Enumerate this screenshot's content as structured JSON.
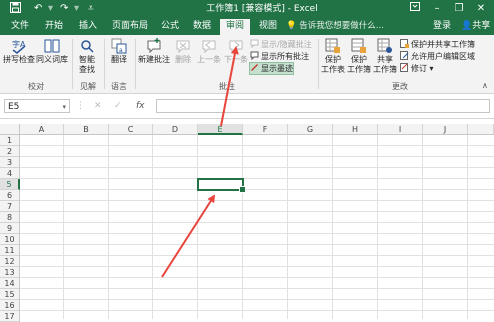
{
  "title_bar": {
    "title": "工作簿1 [兼容模式] - Excel",
    "quick_access": [
      "save-icon",
      "undo-icon",
      "redo-icon",
      "customize-icon"
    ],
    "window_controls": [
      "ribbon-options-icon",
      "minimize-icon",
      "restore-icon",
      "close-icon"
    ]
  },
  "tabs": [
    {
      "label": "文件",
      "active": false
    },
    {
      "label": "开始",
      "active": false
    },
    {
      "label": "插入",
      "active": false
    },
    {
      "label": "页面布局",
      "active": false
    },
    {
      "label": "公式",
      "active": false
    },
    {
      "label": "数据",
      "active": false
    },
    {
      "label": "审阅",
      "active": true
    },
    {
      "label": "视图",
      "active": false
    }
  ],
  "tell_me": "告诉我您想要做什么...",
  "account": {
    "login": "登录",
    "share": "共享"
  },
  "ribbon": {
    "proofing": {
      "label": "校对",
      "spell_check": "拼写检查",
      "thesaurus": "同义词库"
    },
    "insights": {
      "label": "见解",
      "smart_lookup_1": "智能",
      "smart_lookup_2": "查找"
    },
    "language": {
      "label": "语言",
      "translate": "翻译"
    },
    "comments": {
      "label": "批注",
      "new_comment": "新建批注",
      "delete": "删除",
      "previous": "上一条",
      "next": "下一条",
      "show_hide": "显示/隐藏批注",
      "show_all": "显示所有批注",
      "show_ink": "显示墨迹"
    },
    "changes": {
      "label": "更改",
      "protect_sheet_1": "保护",
      "protect_sheet_2": "工作表",
      "protect_workbook_1": "保护",
      "protect_workbook_2": "工作簿",
      "share_workbook_1": "共享",
      "share_workbook_2": "工作簿",
      "protect_share": "保护并共享工作簿",
      "allow_edit": "允许用户编辑区域",
      "track_changes": "修订"
    }
  },
  "formula_bar": {
    "name_box": "E5",
    "cancel": "✕",
    "enter": "✓",
    "fx": "fx",
    "value": ""
  },
  "sheet": {
    "columns": [
      "A",
      "B",
      "C",
      "D",
      "E",
      "F",
      "G",
      "H",
      "I",
      "J"
    ],
    "rows": [
      "1",
      "2",
      "3",
      "4",
      "5",
      "6",
      "7",
      "8",
      "9",
      "10",
      "11",
      "12",
      "13",
      "14",
      "15",
      "16",
      "17"
    ],
    "active_cell": "E5",
    "active_column": "E",
    "active_row": "5"
  },
  "colors": {
    "accent": "#217346",
    "annotation_arrow": "#e8453c"
  }
}
